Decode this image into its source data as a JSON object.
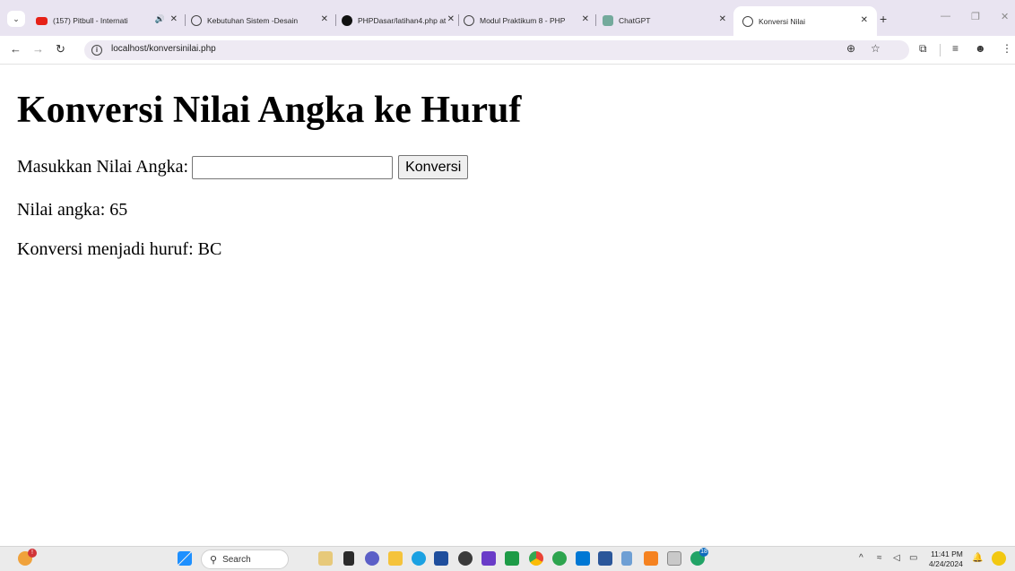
{
  "browser": {
    "tabs": [
      {
        "title": "(157) Pitbull - Internati",
        "icon": "youtube-icon",
        "audio": true
      },
      {
        "title": "Kebutuhan Sistem -Desain",
        "icon": "globe-icon"
      },
      {
        "title": "PHPDasar/latihan4.php at",
        "icon": "github-icon"
      },
      {
        "title": "Modul Praktikum 8 - PHP",
        "icon": "globe-icon"
      },
      {
        "title": "ChatGPT",
        "icon": "chatgpt-icon"
      },
      {
        "title": "Konversi Nilai",
        "icon": "globe-icon",
        "active": true
      }
    ],
    "url": "localhost/konversinilai.php"
  },
  "page": {
    "heading": "Konversi Nilai Angka ke Huruf",
    "input_label": "Masukkan Nilai Angka:",
    "input_value": "",
    "button_label": "Konversi",
    "result_number_label": "Nilai angka: 65",
    "result_letter_label": "Konversi menjadi huruf: BC"
  },
  "taskbar": {
    "search_label": "Search",
    "time": "11:41 PM",
    "date": "4/24/2024",
    "badge_teams": "18"
  }
}
